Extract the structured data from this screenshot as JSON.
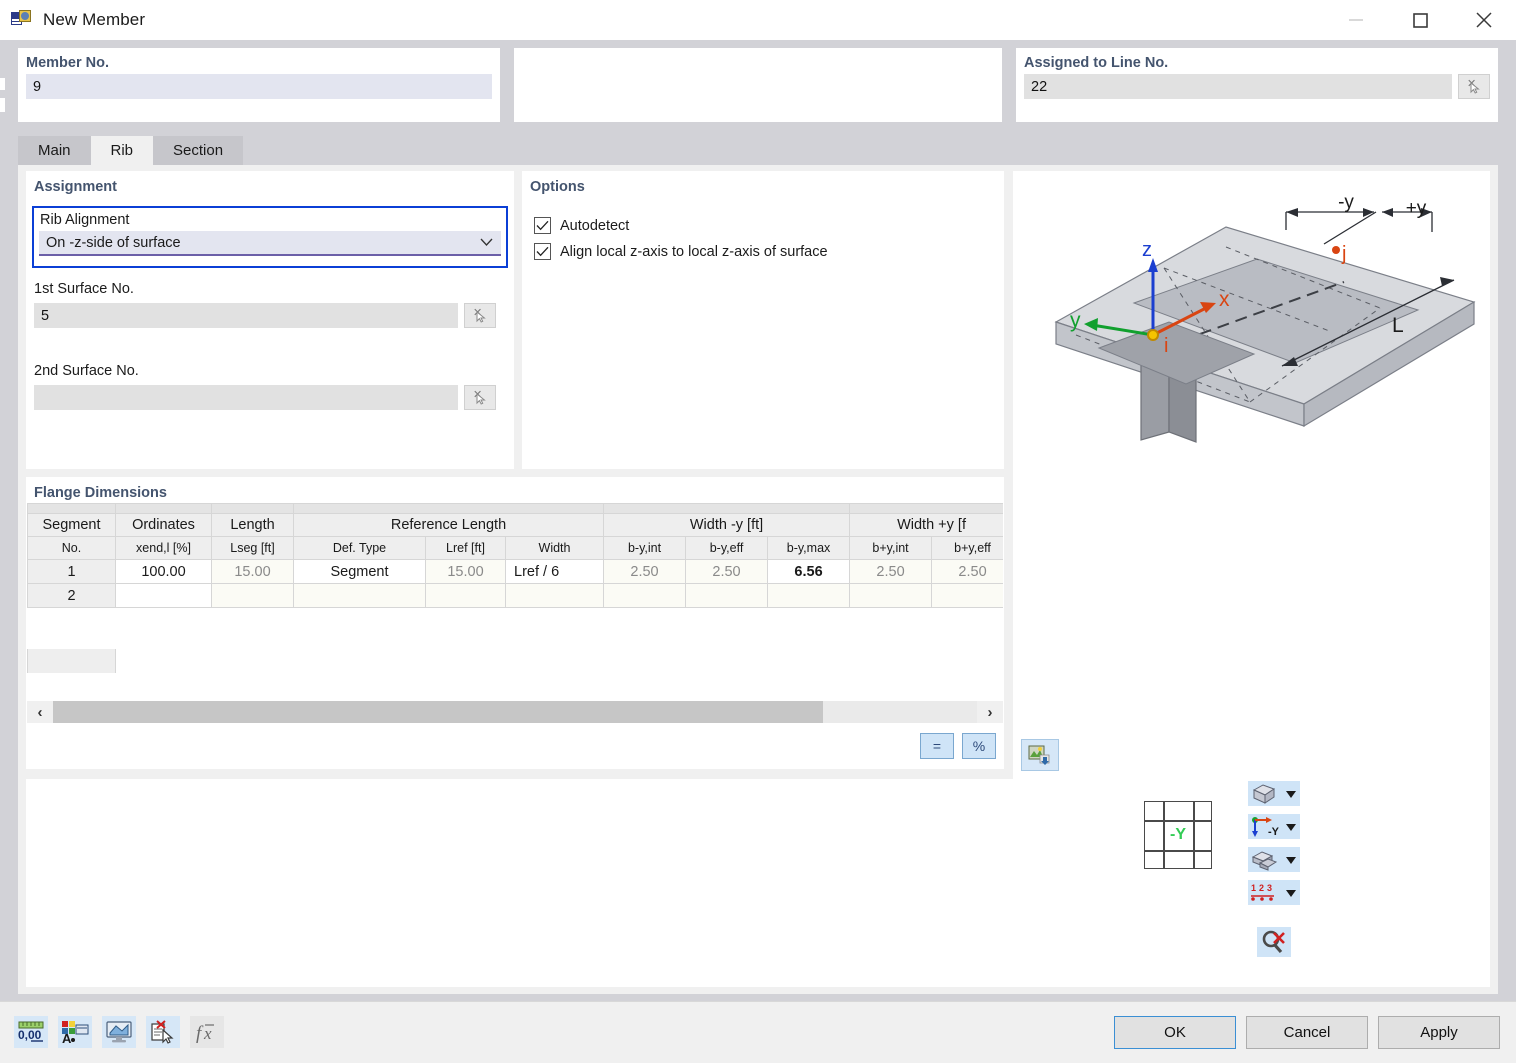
{
  "window": {
    "title": "New Member",
    "icon": "member-icon",
    "minimize": "minimize-icon",
    "maximize": "maximize-icon",
    "close": "close-icon"
  },
  "header": {
    "member_no": {
      "label": "Member No.",
      "value": "9"
    },
    "middle": {
      "label": "",
      "value": ""
    },
    "assigned_line": {
      "label": "Assigned to Line No.",
      "value": "22"
    }
  },
  "tabs": [
    {
      "label": "Main",
      "active": false
    },
    {
      "label": "Rib",
      "active": true
    },
    {
      "label": "Section",
      "active": false
    }
  ],
  "assignment": {
    "title": "Assignment",
    "rib_alignment": {
      "label": "Rib Alignment",
      "value": "On -z-side of surface"
    },
    "first_surface": {
      "label": "1st Surface No.",
      "value": "5"
    },
    "second_surface": {
      "label": "2nd Surface No.",
      "value": ""
    }
  },
  "options": {
    "title": "Options",
    "items": [
      {
        "label": "Autodetect",
        "checked": true
      },
      {
        "label": "Align local z-axis to local z-axis of surface",
        "checked": true
      }
    ]
  },
  "preview": {
    "labels": {
      "z": "z",
      "x": "x",
      "y": "y",
      "i": "i",
      "j": "j",
      "minus_y": "-y",
      "plus_y": "+y",
      "length": "L"
    },
    "snapshot_button": "snapshot-icon"
  },
  "flange": {
    "title": "Flange Dimensions",
    "group_headers": [
      {
        "label": "Segment",
        "span": 1
      },
      {
        "label": "Ordinates",
        "span": 1
      },
      {
        "label": "Length",
        "span": 1
      },
      {
        "label": "Reference Length",
        "span": 3
      },
      {
        "label": "Width -y [ft]",
        "span": 3
      },
      {
        "label": "Width +y [f",
        "span": 2
      }
    ],
    "sub_headers": [
      "No.",
      "xend,l [%]",
      "Lseg [ft]",
      "Def. Type",
      "Lref [ft]",
      "Width",
      "b-y,int",
      "b-y,eff",
      "b-y,max",
      "b+y,int",
      "b+y,eff"
    ],
    "rows": [
      {
        "no": "1",
        "cells": [
          {
            "value": "100.00",
            "style": "normal"
          },
          {
            "value": "15.00",
            "style": "dim"
          },
          {
            "value": "Segment",
            "style": "normal"
          },
          {
            "value": "15.00",
            "style": "dim"
          },
          {
            "value": "Lref / 6",
            "style": "left"
          },
          {
            "value": "2.50",
            "style": "dim"
          },
          {
            "value": "2.50",
            "style": "dim"
          },
          {
            "value": "6.56",
            "style": "bold"
          },
          {
            "value": "2.50",
            "style": "dim"
          },
          {
            "value": "2.50",
            "style": "dim"
          }
        ]
      },
      {
        "no": "2",
        "cells": [
          {
            "value": "",
            "style": "empty"
          },
          {
            "value": "",
            "style": "empty"
          },
          {
            "value": "",
            "style": "empty"
          },
          {
            "value": "",
            "style": "empty"
          },
          {
            "value": "",
            "style": "empty"
          },
          {
            "value": "",
            "style": "empty"
          },
          {
            "value": "",
            "style": "empty"
          },
          {
            "value": "",
            "style": "empty"
          },
          {
            "value": "",
            "style": "empty"
          },
          {
            "value": "",
            "style": "empty"
          }
        ]
      }
    ],
    "scroll_left": "‹",
    "scroll_right": "›",
    "equal_button": "=",
    "percent_button": "%"
  },
  "view_tools": {
    "nav_grid_label": "-Y",
    "buttons": [
      {
        "name": "render-mode-button",
        "icon": "cube-icon"
      },
      {
        "name": "axis-orientation-button",
        "icon": "axes-icon",
        "label": "-Y"
      },
      {
        "name": "surface-display-button",
        "icon": "layers-icon"
      },
      {
        "name": "numbering-button",
        "icon": "numbering-icon",
        "label": "1 2 3"
      },
      {
        "name": "clear-selection-button",
        "icon": "eraser-icon"
      }
    ]
  },
  "bottom_bar": {
    "tools": [
      {
        "name": "units-button",
        "icon": "units-icon",
        "label": "0,00"
      },
      {
        "name": "colors-button",
        "icon": "colors-icon"
      },
      {
        "name": "view-button",
        "icon": "view-icon"
      },
      {
        "name": "delete-doc-button",
        "icon": "delete-doc-icon"
      },
      {
        "name": "formula-button",
        "icon": "fx-icon",
        "label": "fх"
      }
    ],
    "buttons": [
      {
        "label": "OK",
        "default": true
      },
      {
        "label": "Cancel",
        "default": false
      },
      {
        "label": "Apply",
        "default": false
      }
    ]
  }
}
